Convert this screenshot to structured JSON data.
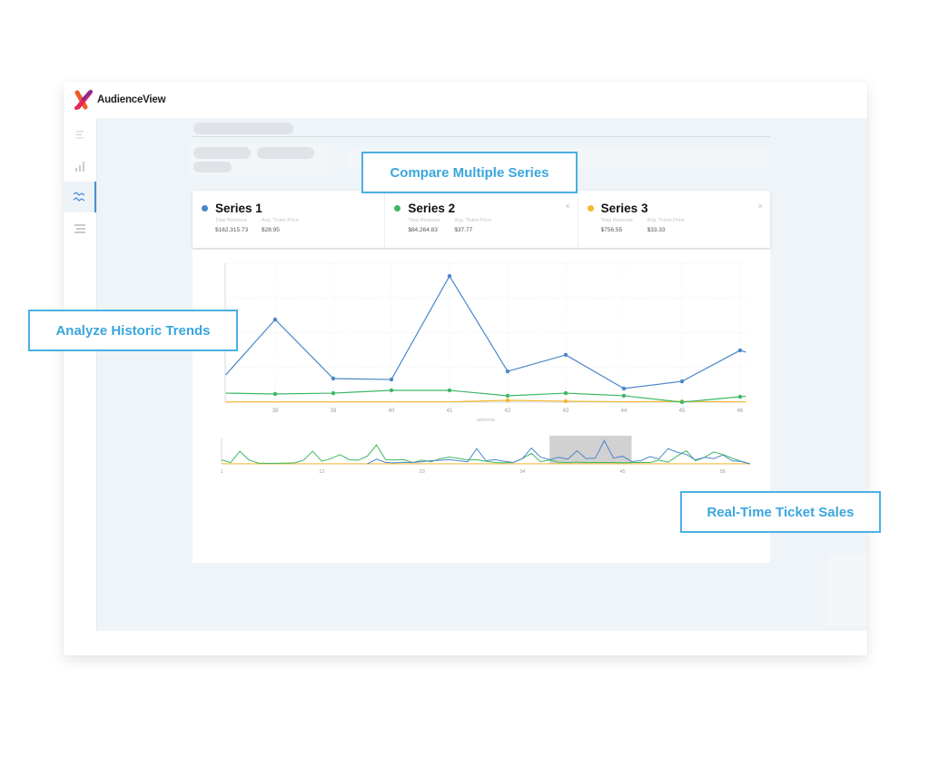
{
  "app": {
    "name": "AudienceView"
  },
  "sidebar": {
    "items": [
      {
        "icon": "menu-icon",
        "active": false
      },
      {
        "icon": "bar-chart-icon",
        "active": false
      },
      {
        "icon": "trend-lines-icon",
        "active": true
      },
      {
        "icon": "list-filter-icon",
        "active": false
      }
    ]
  },
  "callouts": {
    "compare": "Compare Multiple Series",
    "historic": "Analyze Historic Trends",
    "realtime": "Real-Time Ticket Sales"
  },
  "colors": {
    "series1": "#4a86c8",
    "series2": "#3db865",
    "series3": "#f5b82e",
    "callout": "#3aa6de",
    "active_nav": "#4a90d9"
  },
  "series": [
    {
      "name": "Series 1",
      "color": "#4a86c8",
      "revenue_label": "Total Revenue",
      "revenue": "$162,315.73",
      "price_label": "Avg. Ticket Price",
      "price": "$28.95",
      "closable": false
    },
    {
      "name": "Series 2",
      "color": "#3db865",
      "revenue_label": "Total Revenue",
      "revenue": "$84,264.83",
      "price_label": "Avg. Ticket Price",
      "price": "$37.77",
      "closable": true,
      "close": "×"
    },
    {
      "name": "Series 3",
      "color": "#f5b82e",
      "revenue_label": "Total Revenue",
      "revenue": "$756.55",
      "price_label": "Avg. Ticket Price",
      "price": "$33.33",
      "closable": true,
      "close": "×"
    }
  ],
  "chart_data": [
    {
      "type": "line",
      "title": "",
      "xlabel": "MONTHS",
      "ylabel": "",
      "x": [
        37.15,
        38,
        39,
        40,
        41,
        42,
        43,
        44,
        45,
        46,
        46.1
      ],
      "x_ticks": [
        "38",
        "39",
        "40",
        "41",
        "42",
        "43",
        "44",
        "45",
        "46"
      ],
      "ylim": [
        0,
        100
      ],
      "grid": true,
      "series": [
        {
          "name": "Series 1",
          "color": "#4a86c8",
          "values": [
            19.6,
            59.5,
            17.0,
            16.3,
            90.8,
            22.2,
            34.0,
            9.8,
            15.0,
            37.3,
            36.0
          ],
          "markers": [
            false,
            true,
            true,
            true,
            true,
            true,
            true,
            true,
            true,
            true,
            false
          ]
        },
        {
          "name": "Series 2",
          "color": "#3db865",
          "values": [
            6.5,
            5.9,
            6.5,
            8.5,
            8.5,
            4.6,
            6.5,
            4.6,
            0.0,
            3.9,
            4.2
          ],
          "markers": [
            false,
            true,
            true,
            true,
            true,
            true,
            true,
            true,
            true,
            true,
            false
          ]
        },
        {
          "name": "Series 3",
          "color": "#f5b82e",
          "values": [
            0.2,
            0.2,
            0.2,
            0.2,
            0.2,
            1.3,
            0.7,
            0.3,
            0.5,
            0.2,
            0.2
          ],
          "markers": [
            false,
            false,
            false,
            false,
            false,
            true,
            true,
            false,
            true,
            false,
            false
          ]
        }
      ]
    },
    {
      "type": "line",
      "title": "",
      "xlabel": "",
      "ylabel": "",
      "x_ticks": [
        "1",
        "12",
        "23",
        "34",
        "45",
        "56"
      ],
      "xlim": [
        1,
        59
      ],
      "ylim": [
        0,
        100
      ],
      "brush_range": [
        37,
        46
      ],
      "series": [
        {
          "name": "Series 1",
          "color": "#4a86c8",
          "x": [
            17,
            18,
            19,
            20,
            21,
            22,
            23,
            24,
            25,
            26,
            27,
            28,
            29,
            30,
            31,
            32,
            33,
            34,
            35,
            36,
            37,
            38,
            39,
            40,
            41,
            42,
            43,
            44,
            45,
            46,
            47,
            48,
            49,
            50,
            51,
            52,
            53,
            54,
            55,
            56,
            57,
            58,
            59
          ],
          "values": [
            0,
            18,
            5,
            4,
            6,
            5,
            8,
            12,
            14,
            16,
            12,
            8,
            58,
            12,
            16,
            10,
            5,
            20,
            60,
            26,
            16,
            25,
            18,
            50,
            20,
            22,
            88,
            22,
            29,
            9,
            12,
            28,
            19,
            58,
            44,
            36,
            15,
            25,
            20,
            34,
            12,
            9,
            0
          ]
        },
        {
          "name": "Series 2",
          "color": "#3db865",
          "x": [
            1,
            2,
            3,
            4,
            5,
            6,
            7,
            8,
            9,
            10,
            11,
            12,
            13,
            14,
            15,
            16,
            17,
            18,
            19,
            20,
            21,
            22,
            23,
            24,
            25,
            26,
            27,
            28,
            29,
            30,
            31,
            32,
            33,
            34,
            35,
            36,
            37,
            38,
            39,
            40,
            41,
            42,
            43,
            44,
            45,
            46,
            47,
            48,
            49,
            50,
            51,
            52,
            53,
            54,
            55,
            56,
            57,
            58,
            59
          ],
          "values": [
            15,
            5,
            48,
            15,
            3,
            2,
            2,
            3,
            4,
            14,
            48,
            10,
            20,
            35,
            16,
            14,
            30,
            72,
            16,
            15,
            16,
            5,
            14,
            8,
            20,
            26,
            21,
            15,
            16,
            10,
            5,
            4,
            5,
            20,
            40,
            8,
            15,
            6,
            5,
            7,
            5,
            5,
            5,
            5,
            4,
            5,
            5,
            5,
            14,
            6,
            30,
            50,
            12,
            25,
            45,
            36,
            22,
            10,
            0
          ]
        },
        {
          "name": "Series 3",
          "color": "#f5b82e",
          "x": [
            1,
            59
          ],
          "values": [
            0.5,
            0.5
          ]
        }
      ]
    }
  ]
}
